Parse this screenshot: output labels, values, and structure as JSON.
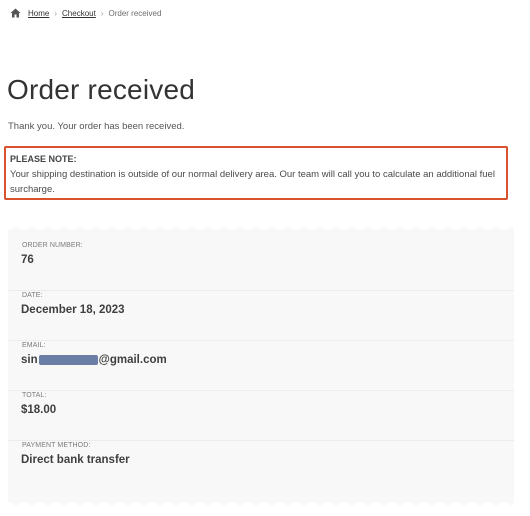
{
  "breadcrumb": {
    "home_label": "Home",
    "checkout_label": "Checkout",
    "current_label": "Order received",
    "separator": "›"
  },
  "page": {
    "title": "Order received",
    "thank_you": "Thank you. Your order has been received."
  },
  "notice": {
    "heading": "PLEASE NOTE:",
    "text": "Your shipping destination is outside of our normal delivery area. Our team will call you to calculate an additional fuel surcharge.",
    "border_color": "#d8522e"
  },
  "order_details": {
    "order_number": {
      "label": "ORDER NUMBER:",
      "value": "76"
    },
    "date": {
      "label": "DATE:",
      "value": "December 18, 2023"
    },
    "email": {
      "label": "EMAIL:",
      "prefix": "sin",
      "suffix": "@gmail.com"
    },
    "total": {
      "label": "TOTAL:",
      "value": "$18.00"
    },
    "payment_method": {
      "label": "PAYMENT METHOD:",
      "value": "Direct bank transfer"
    }
  }
}
